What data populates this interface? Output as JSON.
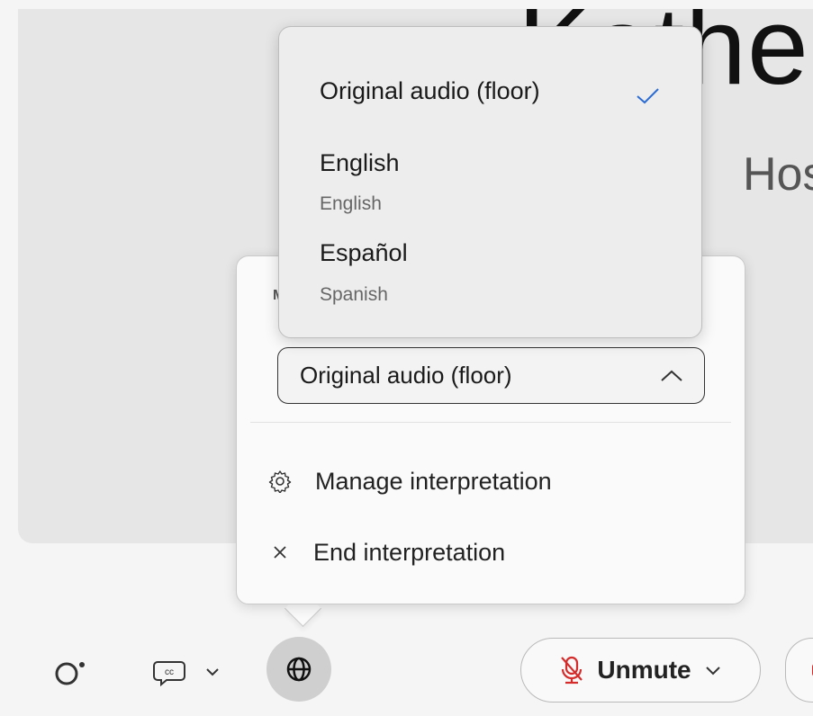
{
  "stage": {
    "presenter_name": "Katheri",
    "presenter_role": "Hos"
  },
  "language_menu": {
    "options": [
      {
        "label": "Original audio (floor)",
        "selected": true
      },
      {
        "label": "English",
        "sublabel": "English"
      },
      {
        "label": "Español",
        "sublabel": "Spanish"
      }
    ],
    "check_icon": "checkmark-icon"
  },
  "interpretation_panel": {
    "section_label": "M",
    "selected_language": "Original audio (floor)",
    "manage_label": "Manage interpretation",
    "end_label": "End interpretation"
  },
  "toolbar": {
    "unmute_label": "Unmute"
  },
  "colors": {
    "accent": "#2b6cd4",
    "mute_red": "#d42b2b"
  }
}
